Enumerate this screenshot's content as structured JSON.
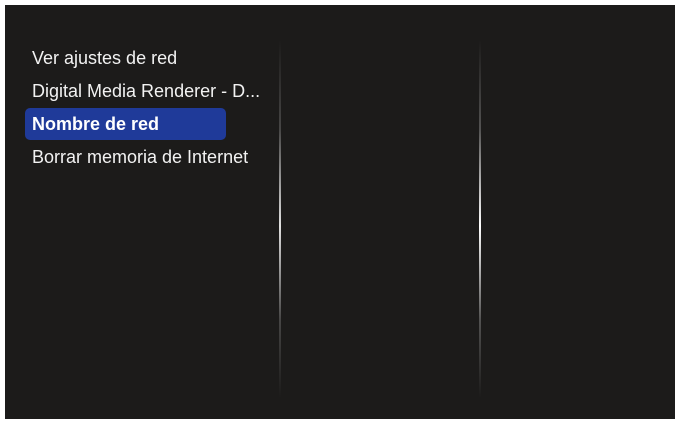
{
  "menu": {
    "items": [
      {
        "label": "Ver ajustes de red",
        "selected": false
      },
      {
        "label": "Digital Media Renderer - D...",
        "selected": false
      },
      {
        "label": "Nombre de red",
        "selected": true
      },
      {
        "label": "Borrar memoria de Internet",
        "selected": false
      }
    ]
  },
  "colors": {
    "background": "#1c1b1a",
    "selection": "#1f3a99",
    "text": "#f2f2f2"
  }
}
